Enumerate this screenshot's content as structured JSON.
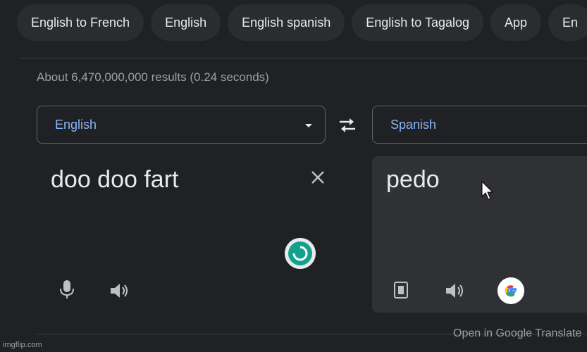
{
  "chips": [
    {
      "label": "English to French"
    },
    {
      "label": "English"
    },
    {
      "label": "English spanish"
    },
    {
      "label": "English to Tagalog"
    },
    {
      "label": "App"
    },
    {
      "label": "En"
    }
  ],
  "result_stats": "About 6,470,000,000 results (0.24 seconds)",
  "translator": {
    "source_language": "English",
    "target_language": "Spanish",
    "source_text": "doo doo fart",
    "translated_text": "pedo",
    "open_link": "Open in Google Translate",
    "icons": {
      "swap": "swap-arrows-icon",
      "clear": "close-icon",
      "mic": "microphone-icon",
      "speaker": "speaker-icon",
      "copy": "copy-icon",
      "brand": "google-g-icon",
      "loading": "loading-spinner-icon"
    }
  },
  "colors": {
    "background": "#202124",
    "surface": "#303134",
    "accent": "#8ab4f8",
    "spinner": "#12a28c"
  },
  "watermark": "imgflip.com"
}
